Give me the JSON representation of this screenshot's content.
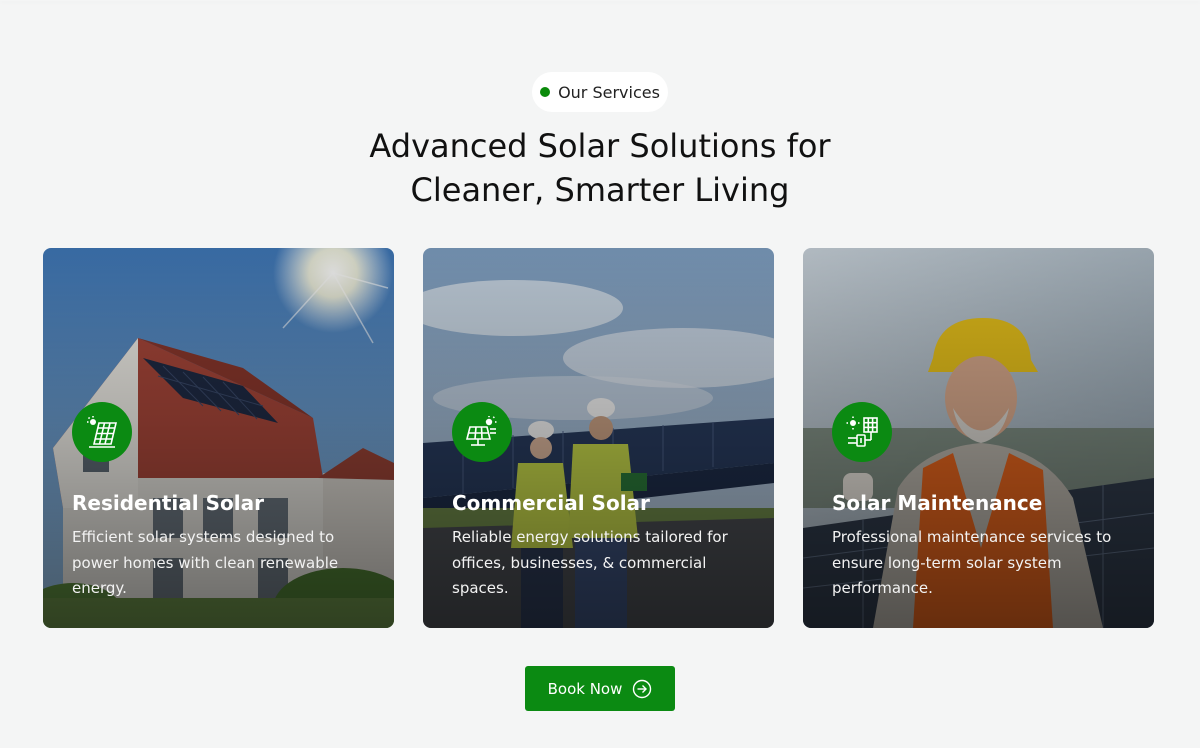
{
  "section": {
    "badge": "Our Services",
    "heading_line1": "Advanced Solar Solutions for",
    "heading_line2": "Cleaner, Smarter Living"
  },
  "cards": [
    {
      "title": "Residential Solar",
      "description": "Efficient solar systems designed to power homes with clean renewable energy.",
      "icon": "solar-panel-sun-icon",
      "image": "house-with-rooftop-solar-photo"
    },
    {
      "title": "Commercial Solar",
      "description": "Reliable energy solutions tailored for offices, businesses, & commercial spaces.",
      "icon": "solar-panel-array-icon",
      "image": "engineers-at-solar-farm-photo"
    },
    {
      "title": "Solar Maintenance",
      "description": "Professional maintenance services to ensure long-term solar system performance.",
      "icon": "solar-maintenance-icon",
      "image": "technician-with-hardhat-photo"
    }
  ],
  "cta": {
    "label": "Book Now",
    "icon": "arrow-right-circle-icon"
  },
  "colors": {
    "accent": "#0b8a12",
    "background": "#f4f5f5",
    "badge_dot": "#0a8a0a"
  }
}
